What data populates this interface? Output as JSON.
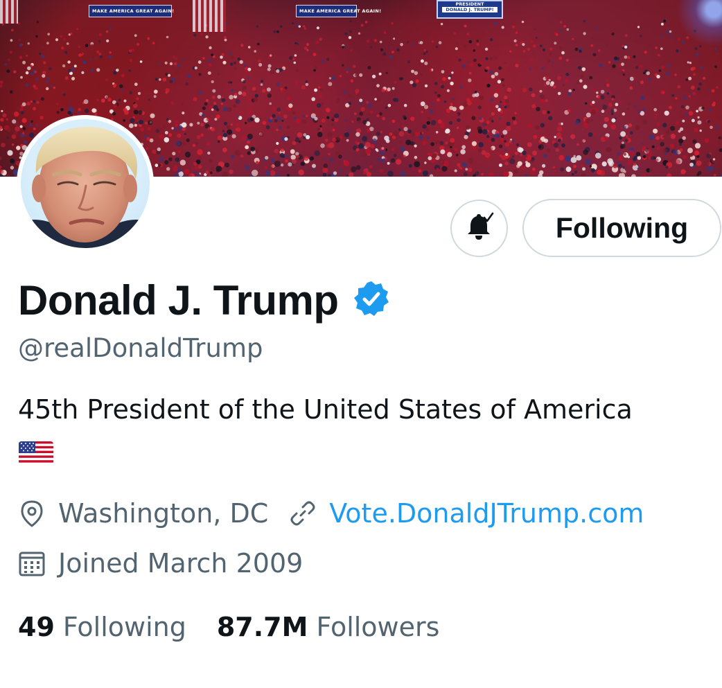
{
  "banner": {
    "sign_left": "MAKE AMERICA GREAT AGAIN!",
    "sign_middle": "MAKE AMERICA GREAT AGAIN!",
    "stage_sign_top": "PRESIDENT",
    "stage_sign_bottom": "DONALD J. TRUMP!"
  },
  "actions": {
    "notify_icon": "bell-check-icon",
    "following_label": "Following"
  },
  "profile": {
    "display_name": "Donald J. Trump",
    "verified_icon": "verified-badge-icon",
    "handle": "@realDonaldTrump",
    "bio": "45th President of the United States of America",
    "bio_emoji": "flag-us-icon",
    "location": "Washington, DC",
    "website": "Vote.DonaldJTrump.com",
    "joined": "Joined March 2009"
  },
  "stats": {
    "following_count": "49",
    "following_label": "Following",
    "followers_count": "87.7M",
    "followers_label": "Followers"
  },
  "colors": {
    "text_primary": "#0f1419",
    "text_secondary": "#536471",
    "link": "#1d9bf0",
    "verified": "#1d9bf0",
    "border": "#cfd9de"
  }
}
